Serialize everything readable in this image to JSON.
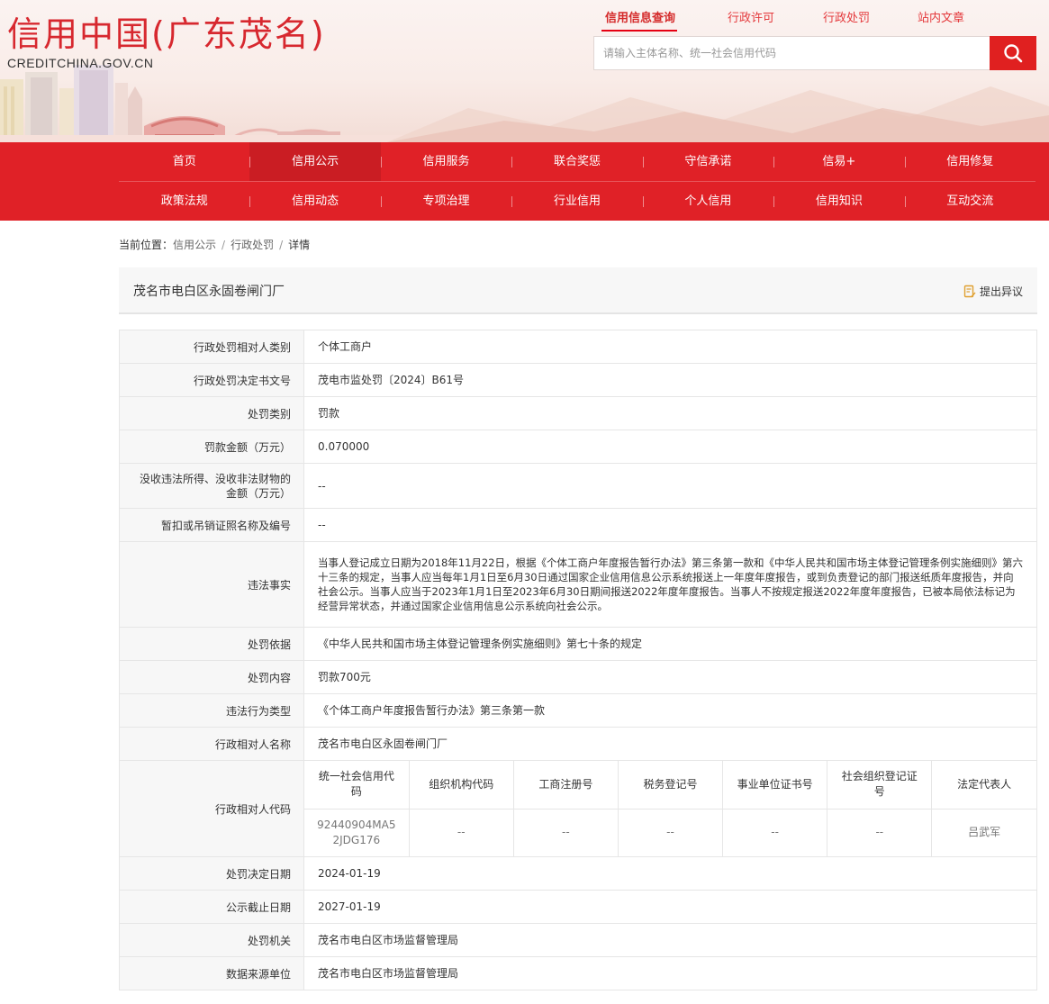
{
  "header": {
    "logo_cn": "信用中国(广东茂名)",
    "logo_en": "CREDITCHINA.GOV.CN",
    "top_links": [
      "信用信息查询",
      "行政许可",
      "行政处罚",
      "站内文章"
    ],
    "search_placeholder": "请输入主体名称、统一社会信用代码"
  },
  "nav": {
    "row1": [
      "首页",
      "信用公示",
      "信用服务",
      "联合奖惩",
      "守信承诺",
      "信易+",
      "信用修复"
    ],
    "row2": [
      "政策法规",
      "信用动态",
      "专项治理",
      "行业信用",
      "个人信用",
      "信用知识",
      "互动交流"
    ]
  },
  "breadcrumb": {
    "prefix": "当前位置：",
    "items": [
      "信用公示",
      "行政处罚",
      "详情"
    ],
    "sep": "/"
  },
  "title": {
    "name": "茂名市电白区永固卷闸门厂",
    "objection": "提出异议"
  },
  "rows": {
    "r1": {
      "k": "行政处罚相对人类别",
      "v": "个体工商户"
    },
    "r2": {
      "k": "行政处罚决定书文号",
      "v": "茂电市监处罚〔2024〕B61号"
    },
    "r3": {
      "k": "处罚类别",
      "v": "罚款"
    },
    "r4": {
      "k": "罚款金额（万元）",
      "v": "0.070000"
    },
    "r5": {
      "k": "没收违法所得、没收非法财物的金额（万元）",
      "v": "--"
    },
    "r6": {
      "k": "暂扣或吊销证照名称及编号",
      "v": "--"
    },
    "r7": {
      "k": "违法事实",
      "v": "当事人登记成立日期为2018年11月22日，根据《个体工商户年度报告暂行办法》第三条第一款和《中华人民共和国市场主体登记管理条例实施细则》第六十三条的规定，当事人应当每年1月1日至6月30日通过国家企业信用信息公示系统报送上一年度年度报告，或到负责登记的部门报送纸质年度报告，并向社会公示。当事人应当于2023年1月1日至2023年6月30日期间报送2022年度年度报告。当事人不按规定报送2022年度年度报告，已被本局依法标记为经营异常状态，并通过国家企业信用信息公示系统向社会公示。"
    },
    "r8": {
      "k": "处罚依据",
      "v": "《中华人民共和国市场主体登记管理条例实施细则》第七十条的规定"
    },
    "r9": {
      "k": "处罚内容",
      "v": "罚款700元"
    },
    "r10": {
      "k": "违法行为类型",
      "v": "《个体工商户年度报告暂行办法》第三条第一款"
    },
    "r11": {
      "k": "行政相对人名称",
      "v": "茂名市电白区永固卷闸门厂"
    },
    "r12": {
      "k": "行政相对人代码"
    },
    "r13": {
      "k": "处罚决定日期",
      "v": "2024-01-19"
    },
    "r14": {
      "k": "公示截止日期",
      "v": "2027-01-19"
    },
    "r15": {
      "k": "处罚机关",
      "v": "茂名市电白区市场监督管理局"
    },
    "r16": {
      "k": "数据来源单位",
      "v": "茂名市电白区市场监督管理局"
    }
  },
  "codes": {
    "headers": [
      "统一社会信用代码",
      "组织机构代码",
      "工商注册号",
      "税务登记号",
      "事业单位证书号",
      "社会组织登记证号",
      "法定代表人"
    ],
    "values": [
      "92440904MA52JDG176",
      "--",
      "--",
      "--",
      "--",
      "--",
      "吕武军"
    ]
  },
  "colors": {
    "brand_red": "#e02127",
    "active_nav": "#ca1d23",
    "search_button": "#e02020"
  }
}
